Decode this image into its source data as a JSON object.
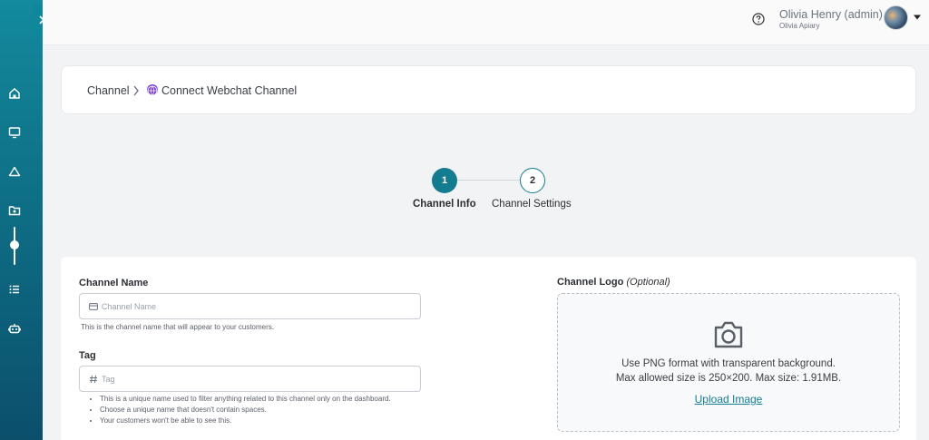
{
  "header": {
    "user_name": "Olivia Henry (admin)",
    "user_org": "Olivia Apiary"
  },
  "breadcrumb": {
    "parent": "Channel",
    "current": "Connect Webchat Channel"
  },
  "stepper": {
    "steps": [
      {
        "number": "1",
        "label": "Channel Info"
      },
      {
        "number": "2",
        "label": "Channel Settings"
      }
    ]
  },
  "form": {
    "channel_name": {
      "label": "Channel Name",
      "placeholder": "Channel Name",
      "value": "",
      "help": "This is the channel name that will appear to your customers."
    },
    "tag": {
      "label": "Tag",
      "placeholder": "Tag",
      "value": "",
      "bullets": [
        "This is a unique name used to filter anything related to this channel only on the dashboard.",
        "Choose a unique name that doesn't contain spaces.",
        "Your customers won't be able to see this."
      ]
    },
    "logo": {
      "label": "Channel Logo",
      "optional": "(Optional)",
      "line1": "Use PNG format with transparent background.",
      "line2": "Max allowed size is 250×200. Max size: 1.91MB.",
      "upload_label": "Upload Image"
    }
  },
  "colors": {
    "accent": "#137c90",
    "sidebar_top": "#138a9e",
    "sidebar_bottom": "#0b4f6b",
    "globe": "#7b3fd1"
  },
  "icons": {
    "sidebar": [
      "home-icon",
      "monitor-icon",
      "triangle-icon",
      "folder-icon",
      "list-icon",
      "bot-icon"
    ],
    "header": [
      "help-icon",
      "chevron-down-icon"
    ],
    "form": [
      "card-icon",
      "hash-icon",
      "camera-icon"
    ]
  }
}
